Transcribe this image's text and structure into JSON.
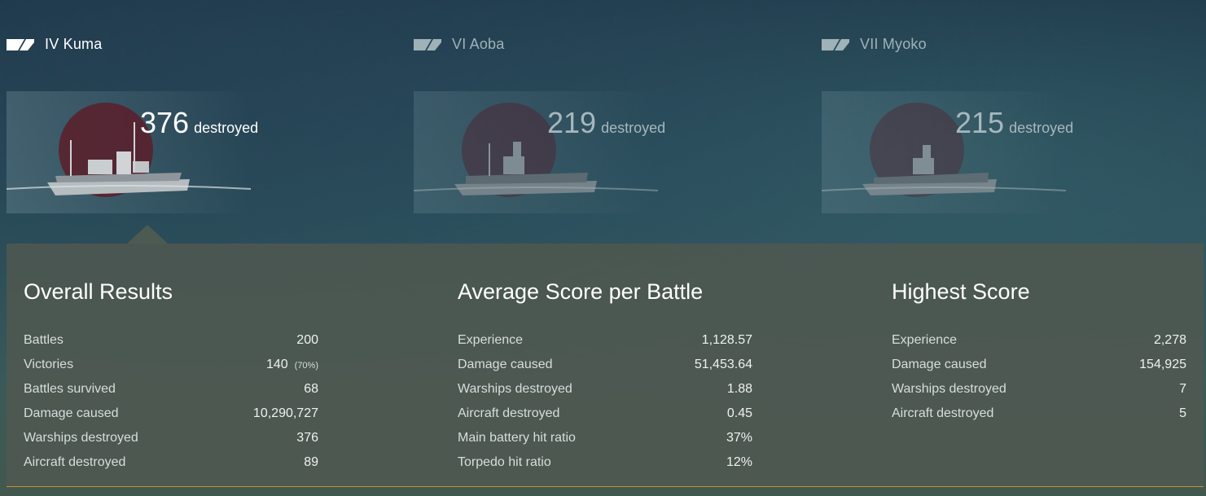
{
  "ships": [
    {
      "name": "IV Kuma",
      "destroyed_count": "376",
      "destroyed_label": "destroyed",
      "active": true
    },
    {
      "name": "VI Aoba",
      "destroyed_count": "219",
      "destroyed_label": "destroyed",
      "active": false
    },
    {
      "name": "VII Myoko",
      "destroyed_count": "215",
      "destroyed_label": "destroyed",
      "active": false
    }
  ],
  "overall": {
    "title": "Overall Results",
    "rows": [
      {
        "label": "Battles",
        "value": "200"
      },
      {
        "label": "Victories",
        "value": "140",
        "pct": "(70%)"
      },
      {
        "label": "Battles survived",
        "value": "68"
      },
      {
        "label": "Damage caused",
        "value": "10,290,727"
      },
      {
        "label": "Warships destroyed",
        "value": "376"
      },
      {
        "label": "Aircraft destroyed",
        "value": "89"
      }
    ]
  },
  "average": {
    "title": "Average Score per Battle",
    "rows": [
      {
        "label": "Experience",
        "value": "1,128.57"
      },
      {
        "label": "Damage caused",
        "value": "51,453.64"
      },
      {
        "label": "Warships destroyed",
        "value": "1.88"
      },
      {
        "label": "Aircraft destroyed",
        "value": "0.45"
      },
      {
        "label": "Main battery hit ratio",
        "value": "37%"
      },
      {
        "label": "Torpedo hit ratio",
        "value": "12%"
      }
    ]
  },
  "highest": {
    "title": "Highest Score",
    "rows": [
      {
        "label": "Experience",
        "value": "2,278"
      },
      {
        "label": "Damage caused",
        "value": "154,925"
      },
      {
        "label": "Warships destroyed",
        "value": "7"
      },
      {
        "label": "Aircraft destroyed",
        "value": "5"
      }
    ]
  },
  "colors": {
    "accent_line": "#c7912a",
    "flag_red": "#5a1e2a",
    "panel_bg": "#4e5850"
  },
  "icons": {
    "ship_class": "cruiser-class-icon"
  }
}
